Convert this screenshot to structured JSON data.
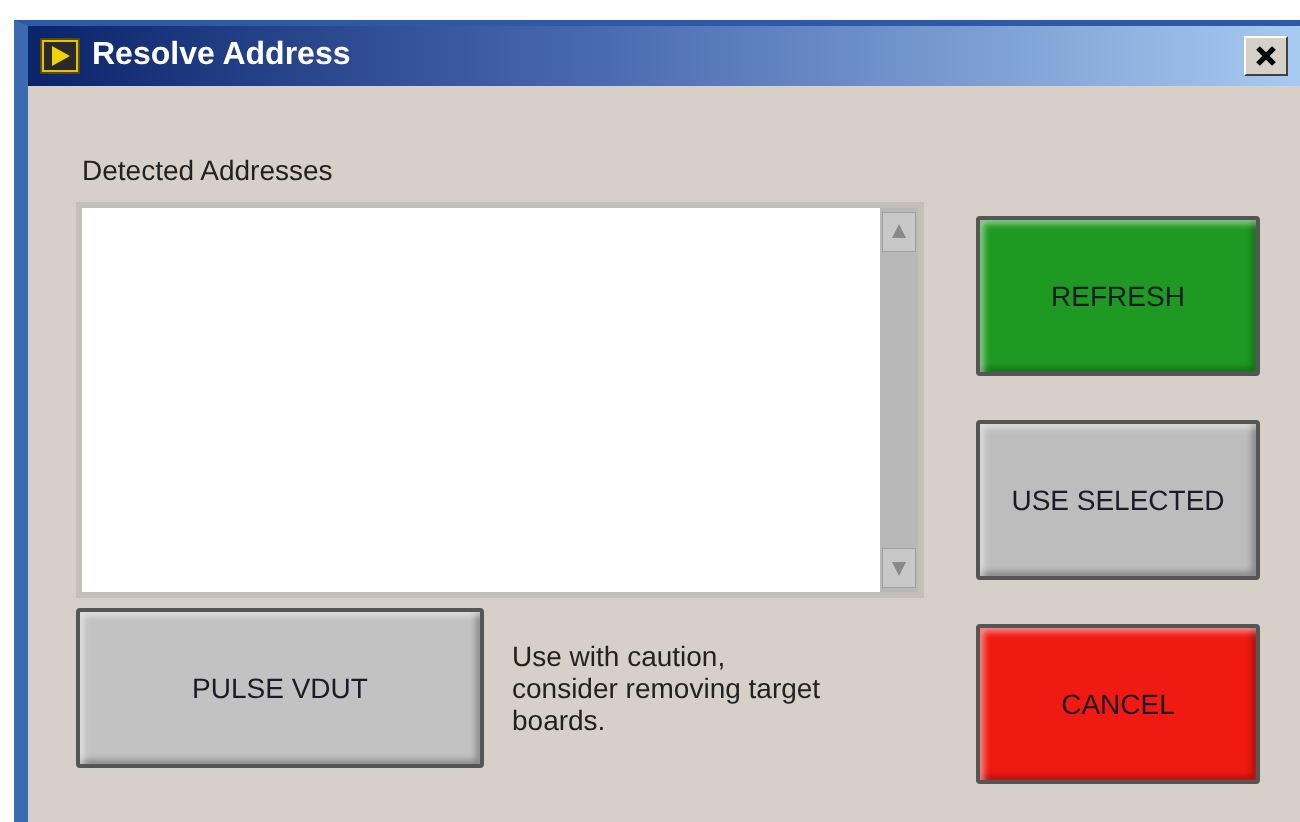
{
  "window": {
    "title": "Resolve Address"
  },
  "list": {
    "label": "Detected Addresses"
  },
  "pulse_button": {
    "label": "PULSE VDUT"
  },
  "caution_note": "Use with caution, consider removing target boards.",
  "buttons": [
    {
      "label": "REFRESH",
      "color": "#1e9a22"
    },
    {
      "label": "USE SELECTED",
      "color": "#bdbdbd"
    },
    {
      "label": "CANCEL",
      "color": "#f01a12"
    }
  ]
}
